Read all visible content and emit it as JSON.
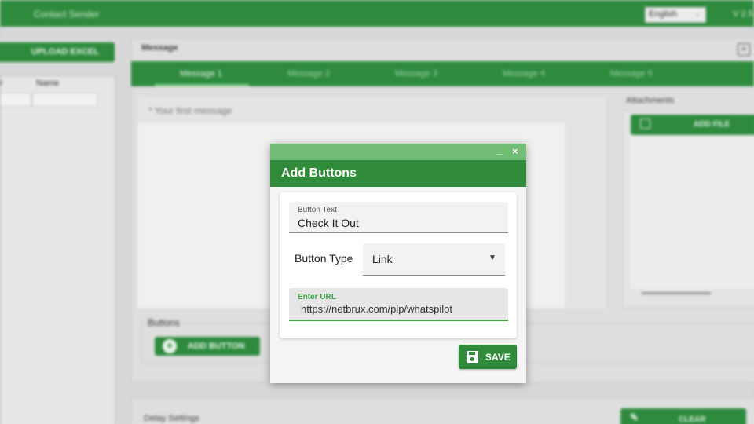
{
  "app": {
    "title": "Contact Sender",
    "language": "English",
    "version": "V 2.5"
  },
  "left_panel": {
    "upload_label": "UPLOAD EXCEL",
    "columns": [
      "r",
      "Name"
    ]
  },
  "message": {
    "section_label": "Message",
    "tabs": [
      {
        "label": "Message 1",
        "active": true
      },
      {
        "label": "Message 2",
        "active": false
      },
      {
        "label": "Message 3",
        "active": false
      },
      {
        "label": "Message 4",
        "active": false
      },
      {
        "label": "Message 5",
        "active": false
      }
    ],
    "placeholder": "* Your first message"
  },
  "attachments": {
    "label": "Attachments",
    "add_file_label": "ADD FILE"
  },
  "buttons_section": {
    "legend": "Buttons",
    "add_button_label": "ADD BUTTON"
  },
  "delay": {
    "label": "Delay Settings",
    "clear_label": "CLEAR"
  },
  "dialog": {
    "minimize_glyph": "_",
    "close_glyph": "×",
    "title": "Add Buttons",
    "button_text": {
      "label": "Button Text",
      "value": "Check It Out"
    },
    "button_type": {
      "label": "Button Type",
      "selected": "Link"
    },
    "url": {
      "label": "Enter URL",
      "value": "https://netbrux.com/plp/whatspilot"
    },
    "save_label": "SAVE"
  },
  "colors": {
    "primary_green": "#2e8b3e",
    "titlebar_green": "#72bd76",
    "focus_green": "#3aa34a"
  }
}
